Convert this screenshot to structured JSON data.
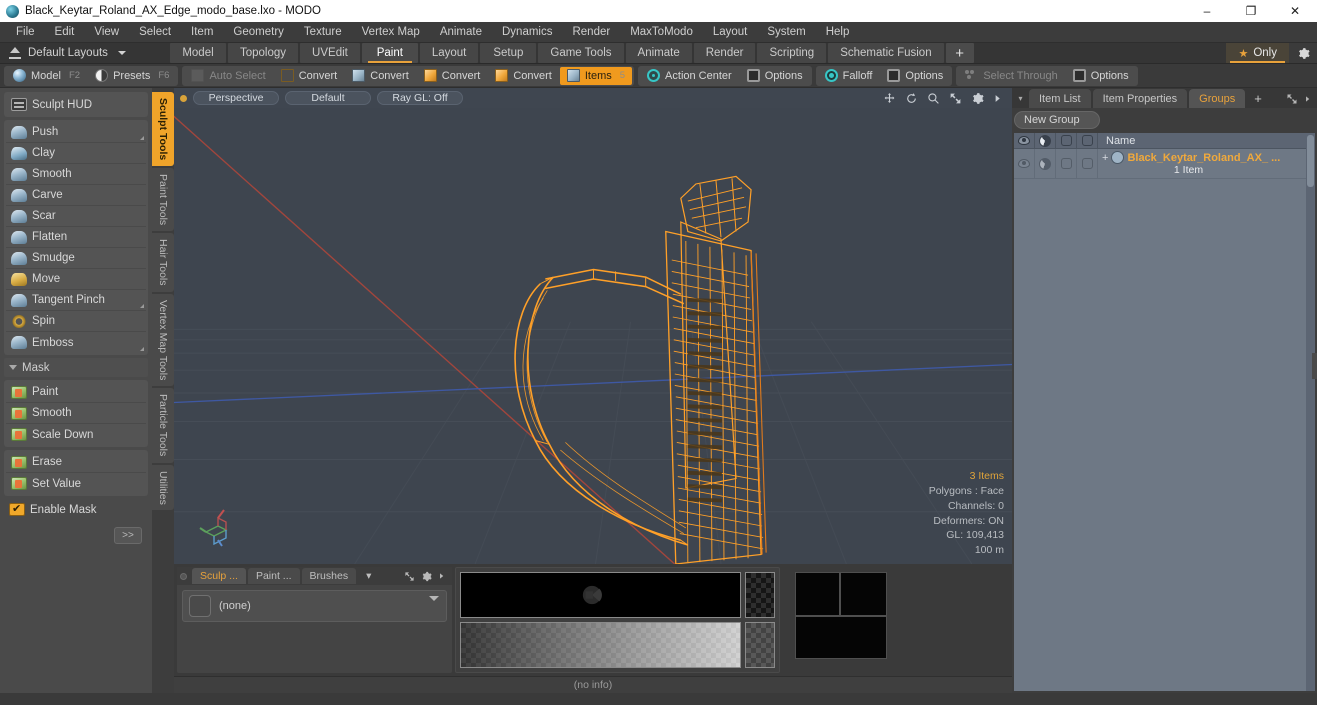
{
  "window": {
    "title": "Black_Keytar_Roland_AX_Edge_modo_base.lxo - MODO",
    "minimize": "–",
    "maximize": "❐",
    "close": "✕"
  },
  "menubar": {
    "items": [
      "File",
      "Edit",
      "View",
      "Select",
      "Item",
      "Geometry",
      "Texture",
      "Vertex Map",
      "Animate",
      "Dynamics",
      "Render",
      "MaxToModo",
      "Layout",
      "System",
      "Help"
    ]
  },
  "layoutbar": {
    "layouts_label": "Default Layouts",
    "tabs": [
      {
        "label": "Model",
        "active": false
      },
      {
        "label": "Topology",
        "active": false
      },
      {
        "label": "UVEdit",
        "active": false
      },
      {
        "label": "Paint",
        "active": true
      },
      {
        "label": "Layout",
        "active": false
      },
      {
        "label": "Setup",
        "active": false
      },
      {
        "label": "Game Tools",
        "active": false
      },
      {
        "label": "Animate",
        "active": false
      },
      {
        "label": "Render",
        "active": false
      },
      {
        "label": "Scripting",
        "active": false
      },
      {
        "label": "Schematic Fusion",
        "active": false
      }
    ],
    "add_tab": "+",
    "only_label": "Only",
    "only_star": "★",
    "gear": "⚙"
  },
  "modebar": {
    "group1": [
      {
        "label": "Model",
        "key": "F2",
        "icon": "sphere-icon",
        "selected": false
      },
      {
        "label": "Presets",
        "key": "F6",
        "icon": "half-sphere-icon",
        "selected": false
      }
    ],
    "group2": [
      {
        "label": "Auto Select",
        "icon": "cube-dim-icon",
        "dim": true
      },
      {
        "label": "Convert",
        "icon": "cube-blue-icon",
        "dim": false
      },
      {
        "label": "Convert",
        "icon": "cube-yellow-icon",
        "dim": false
      },
      {
        "label": "Convert",
        "icon": "cube-orange-icon",
        "dim": false
      },
      {
        "label": "Convert",
        "icon": "cube-gray-icon",
        "dim": false
      },
      {
        "label": "Items",
        "icon": "cube-white-icon",
        "selected": true,
        "key": "5"
      }
    ],
    "group3": [
      {
        "label": "Action Center",
        "icon": "target-icon"
      },
      {
        "label": "Options",
        "icon": "square-icon"
      }
    ],
    "group4": [
      {
        "label": "Falloff",
        "icon": "falloff-icon"
      },
      {
        "label": "Options",
        "icon": "square-icon"
      }
    ],
    "group5": [
      {
        "label": "Select Through",
        "icon": "dots-icon",
        "dim": true
      },
      {
        "label": "Options",
        "icon": "square-icon"
      }
    ]
  },
  "left_panel": {
    "hud": {
      "label": "Sculpt HUD",
      "icon": "hud-icon"
    },
    "brushes": [
      {
        "label": "Push",
        "icon": "brush-icon",
        "has_corner": true
      },
      {
        "label": "Clay",
        "icon": "clay-icon"
      },
      {
        "label": "Smooth",
        "icon": "brush-icon"
      },
      {
        "label": "Carve",
        "icon": "brush-icon"
      },
      {
        "label": "Scar",
        "icon": "brush-icon"
      },
      {
        "label": "Flatten",
        "icon": "brush-icon"
      },
      {
        "label": "Smudge",
        "icon": "brush-icon"
      },
      {
        "label": "Move",
        "icon": "yellow-brush-icon"
      },
      {
        "label": "Tangent Pinch",
        "icon": "brush-icon",
        "has_corner": true
      },
      {
        "label": "Spin",
        "icon": "spin-icon"
      },
      {
        "label": "Emboss",
        "icon": "brush-icon",
        "has_corner": true
      }
    ],
    "mask_header": "Mask",
    "mask_tools": [
      {
        "label": "Paint",
        "icon": "mask-icon"
      },
      {
        "label": "Smooth",
        "icon": "mask-icon"
      },
      {
        "label": "Scale Down",
        "icon": "mask-icon"
      }
    ],
    "mask_tools2": [
      {
        "label": "Erase",
        "icon": "mask-icon"
      },
      {
        "label": "Set Value",
        "icon": "mask-icon"
      }
    ],
    "enable_mask": {
      "label": "Enable Mask",
      "checked": true
    },
    "expand": ">>"
  },
  "vertical_tabs": [
    {
      "label": "Sculpt Tools",
      "active": true
    },
    {
      "label": "Paint Tools",
      "active": false
    },
    {
      "label": "Hair Tools",
      "active": false
    },
    {
      "label": "Vertex Map Tools",
      "active": false
    },
    {
      "label": "Particle Tools",
      "active": false
    },
    {
      "label": "Utilities",
      "active": false
    }
  ],
  "viewport": {
    "view_name": "Perspective",
    "shading": "Default",
    "raygl": "Ray GL: Off",
    "icons": [
      "move-icon",
      "rotate-icon",
      "zoom-icon",
      "fit-icon",
      "gear-icon",
      "arrow-right-icon"
    ],
    "stats": {
      "items": "3 Items",
      "polygons": "Polygons : Face",
      "channels": "Channels: 0",
      "deformers": "Deformers: ON",
      "gl": "GL: 109,413",
      "scale": "100 m"
    },
    "background_color": "#3e454f",
    "wireframe_color": "#ffa028",
    "axis_x_color": "#a8463c",
    "axis_z_color": "#3f5aa8"
  },
  "bottom_dock": {
    "tabs": [
      {
        "label": "Sculp ...",
        "active": true
      },
      {
        "label": "Paint ...",
        "active": false
      },
      {
        "label": "Brushes",
        "active": false
      }
    ],
    "dropdown_caret": "▾",
    "preset_value": "(none)",
    "tools": [
      "expand-icon",
      "gear-icon",
      "arrow-right-icon"
    ]
  },
  "statusbar": {
    "info": "(no info)"
  },
  "right_panel": {
    "tabs": [
      {
        "label": "Item List",
        "active": false
      },
      {
        "label": "Item Properties",
        "active": false
      },
      {
        "label": "Groups",
        "active": true
      }
    ],
    "add_tab": "+",
    "new_group_button": "New Group",
    "columns": [
      "eye-icon",
      "light-icon",
      "render-icon",
      "shadow-icon",
      "Name"
    ],
    "rows": [
      {
        "name": "Black_Keytar_Roland_AX_ ...",
        "sub": "1 Item",
        "expand": "+",
        "icon": "group-icon"
      }
    ]
  }
}
